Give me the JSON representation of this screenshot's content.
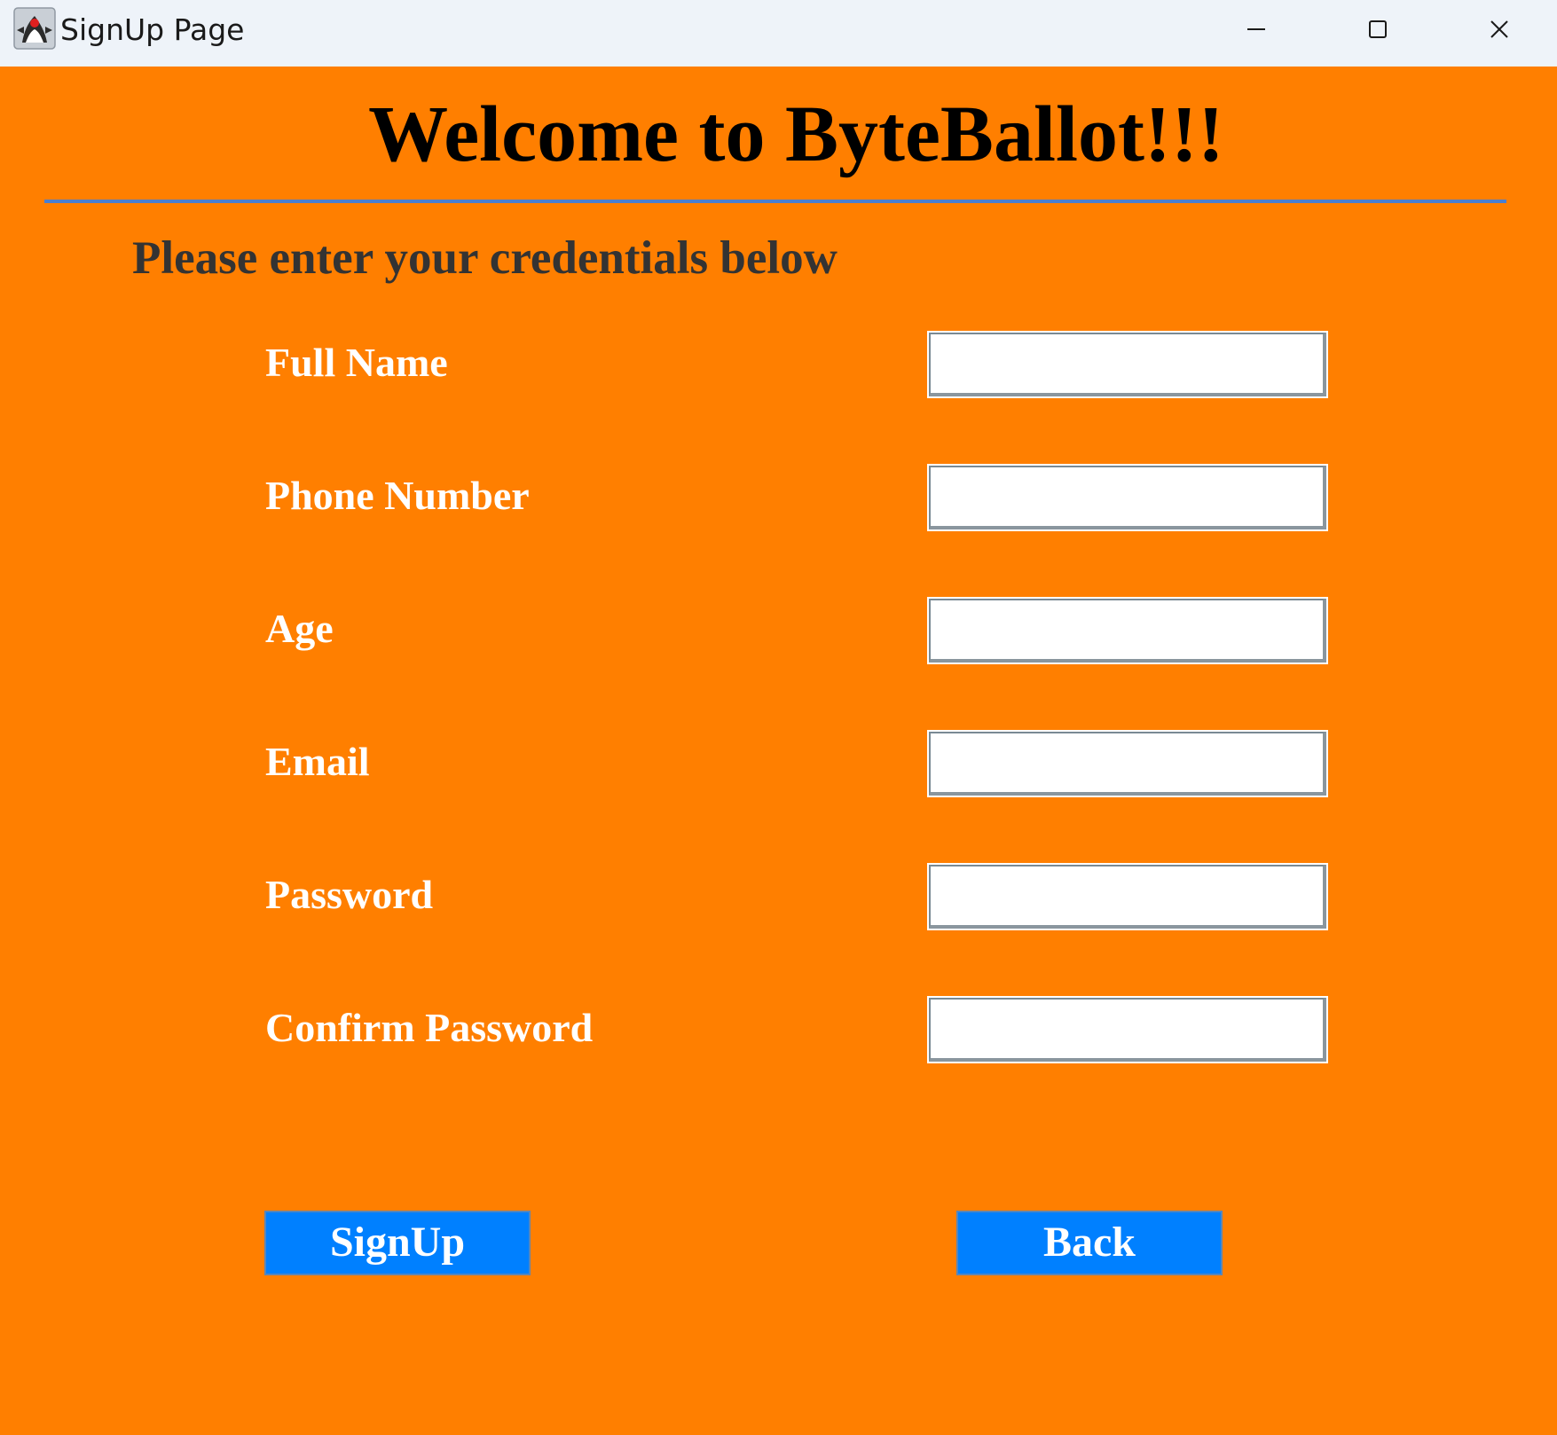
{
  "window": {
    "title": "SignUp Page",
    "app_icon": "java-duke-icon",
    "controls": {
      "minimize_icon": "minimize-icon",
      "maximize_icon": "maximize-icon",
      "close_icon": "close-icon"
    }
  },
  "header": {
    "title": "Welcome to ByteBallot!!!",
    "subtitle": "Please enter your credentials below"
  },
  "form": {
    "fields": [
      {
        "label": "Full Name",
        "value": ""
      },
      {
        "label": "Phone Number",
        "value": ""
      },
      {
        "label": "Age",
        "value": ""
      },
      {
        "label": "Email",
        "value": ""
      },
      {
        "label": "Password",
        "value": ""
      },
      {
        "label": "Confirm Password",
        "value": ""
      }
    ]
  },
  "actions": {
    "signup_label": "SignUp",
    "back_label": "Back"
  },
  "colors": {
    "background": "#ff7f00",
    "button": "#0080ff",
    "divider": "#4a7fd1",
    "titlebar": "#eef3f9"
  }
}
